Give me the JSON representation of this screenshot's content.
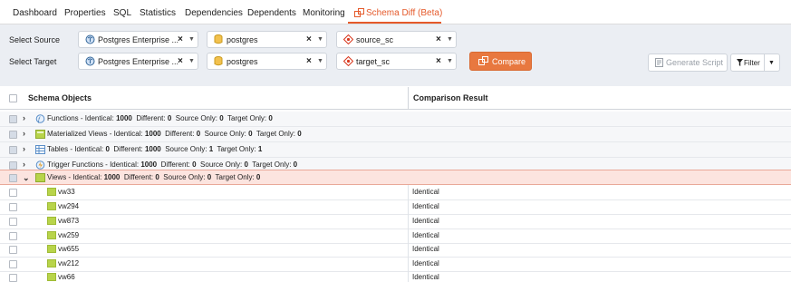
{
  "tabs": [
    "Dashboard",
    "Properties",
    "SQL",
    "Statistics",
    "Dependencies",
    "Dependents",
    "Monitoring",
    "Schema Diff (Beta)"
  ],
  "active_tab": "Schema Diff (Beta)",
  "toolbar": {
    "select_source_label": "Select Source",
    "select_target_label": "Select Target",
    "source": {
      "server": "Postgres Enterprise ...",
      "database": "postgres",
      "schema": "source_sc"
    },
    "target": {
      "server": "Postgres Enterprise ...",
      "database": "postgres",
      "schema": "target_sc"
    },
    "clear_symbol": "×",
    "compare_label": "Compare",
    "generate_script_label": "Generate Script",
    "filter_label": "Filter"
  },
  "grid": {
    "col_objects": "Schema Objects",
    "col_result": "Comparison Result",
    "labels": {
      "identical": "Identical:",
      "different": "Different:",
      "source_only": "Source Only:",
      "target_only": "Target Only:"
    },
    "groups": [
      {
        "name": "Functions - ",
        "identical": "1000",
        "different": "0",
        "source_only": "0",
        "target_only": "0",
        "icon": "function-icon",
        "expanded": false
      },
      {
        "name": "Materialized Views - ",
        "identical": "1000",
        "different": "0",
        "source_only": "0",
        "target_only": "0",
        "icon": "materialized-view-icon",
        "expanded": false
      },
      {
        "name": "Tables - ",
        "identical": "0",
        "different": "1000",
        "source_only": "1",
        "target_only": "1",
        "icon": "table-icon",
        "expanded": false
      },
      {
        "name": "Trigger Functions - ",
        "identical": "1000",
        "different": "0",
        "source_only": "0",
        "target_only": "0",
        "icon": "trigger-function-icon",
        "expanded": false
      },
      {
        "name": "Views - ",
        "identical": "1000",
        "different": "0",
        "source_only": "0",
        "target_only": "0",
        "icon": "view-icon",
        "expanded": true
      }
    ],
    "view_rows": [
      {
        "name": "vw33",
        "result": "Identical"
      },
      {
        "name": "vw294",
        "result": "Identical"
      },
      {
        "name": "vw873",
        "result": "Identical"
      },
      {
        "name": "vw259",
        "result": "Identical"
      },
      {
        "name": "vw655",
        "result": "Identical"
      },
      {
        "name": "vw212",
        "result": "Identical"
      },
      {
        "name": "vw66",
        "result": "Identical"
      }
    ]
  },
  "colors": {
    "accent": "#e55a2b",
    "compare_button": "#e8783f",
    "toolbar_bg": "#ebeef3",
    "active_row": "#fce4df",
    "view_icon": "#b8d44a"
  }
}
